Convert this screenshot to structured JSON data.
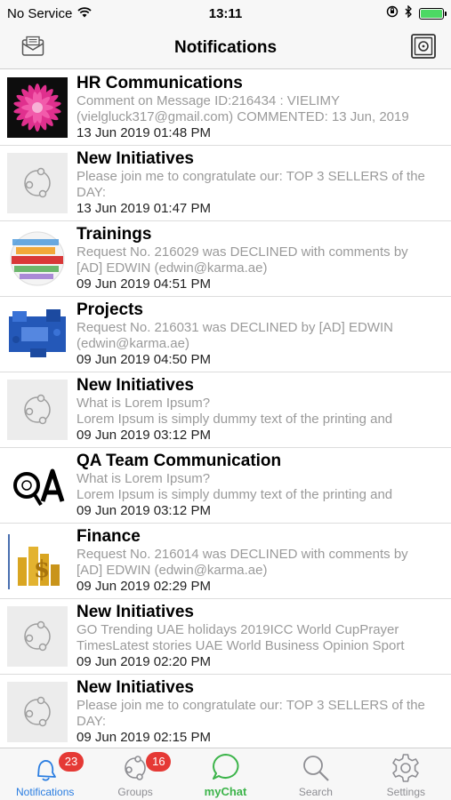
{
  "status": {
    "carrier": "No Service",
    "time": "13:11"
  },
  "nav": {
    "title": "Notifications",
    "left_icon": "inbox-icon",
    "right_icon": "safe-icon"
  },
  "notifications": [
    {
      "title": "HR Communications",
      "body": "Comment on Message ID:216434 : VIELIMY (vielgluck317@gmail.com) COMMENTED: 13 Jun, 2019",
      "date": "13 Jun 2019 01:48 PM",
      "thumb": "pink-flower-photo"
    },
    {
      "title": "New Initiatives",
      "body": " Please join me to congratulate our: TOP 3 SELLERS of the DAY:",
      "date": "13 Jun 2019 01:47 PM",
      "thumb": "share-icon"
    },
    {
      "title": "Trainings",
      "body": "Request No. 216029 was DECLINED with comments by [AD] EDWIN (edwin@karma.ae)",
      "date": "09 Jun 2019 04:51 PM",
      "thumb": "training-word-ball"
    },
    {
      "title": "Projects",
      "body": "Request No. 216031 was DECLINED by [AD] EDWIN (edwin@karma.ae)",
      "date": "09 Jun 2019 04:50 PM",
      "thumb": "puzzle-project-image"
    },
    {
      "title": "New Initiatives",
      "body": " What is Lorem Ipsum?\nLorem Ipsum is simply dummy text of the printing and",
      "date": "09 Jun 2019 03:12 PM",
      "thumb": "share-icon"
    },
    {
      "title": "QA Team Communication",
      "body": " What is Lorem Ipsum?\nLorem Ipsum is simply dummy text of the printing and",
      "date": "09 Jun 2019 03:12 PM",
      "thumb": "qa-logo"
    },
    {
      "title": "Finance",
      "body": "Request No. 216014 was DECLINED with comments by [AD] EDWIN (edwin@karma.ae)",
      "date": "09 Jun 2019 02:29 PM",
      "thumb": "gold-coins-image"
    },
    {
      "title": "New Initiatives",
      "body": "GO Trending UAE holidays 2019ICC World CupPrayer TimesLatest stories UAE World Business Opinion Sport",
      "date": "09 Jun 2019 02:20 PM",
      "thumb": "share-icon"
    },
    {
      "title": "New Initiatives",
      "body": " Please join me to congratulate our: TOP 3 SELLERS of the DAY:",
      "date": "09 Jun 2019 02:15 PM",
      "thumb": "share-icon"
    }
  ],
  "tabs": [
    {
      "label": "Notifications",
      "badge": "23",
      "icon": "bell-icon"
    },
    {
      "label": "Groups",
      "badge": "16",
      "icon": "groups-icon"
    },
    {
      "label": "myChat",
      "badge": "",
      "icon": "chat-bubble-icon"
    },
    {
      "label": "Search",
      "badge": "",
      "icon": "search-icon"
    },
    {
      "label": "Settings",
      "badge": "",
      "icon": "gear-icon"
    }
  ],
  "colors": {
    "active_tab": "#2a7de1",
    "chat_green": "#3cb44a",
    "badge": "#e53935",
    "battery": "#4cd964"
  }
}
